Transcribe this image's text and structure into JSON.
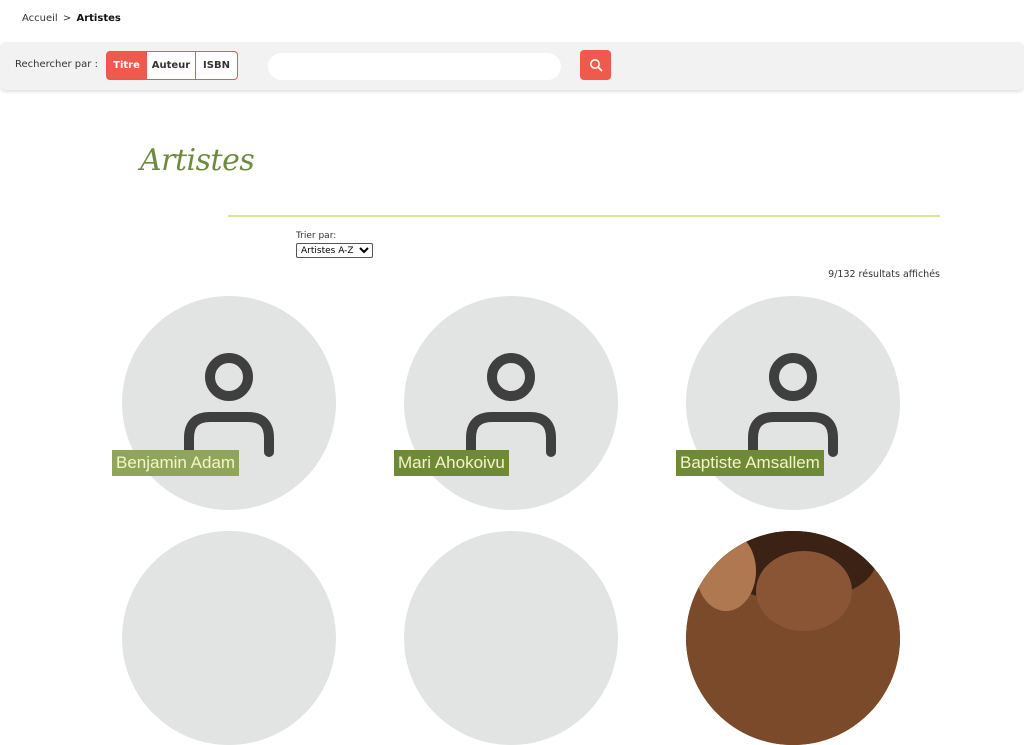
{
  "breadcrumb": {
    "home": "Accueil",
    "separator": ">",
    "current": "Artistes"
  },
  "search": {
    "label": "Rechercher par :",
    "options": [
      "Titre",
      "Auteur",
      "ISBN"
    ],
    "selected": "Titre",
    "placeholder": "",
    "value": ""
  },
  "page": {
    "title": "Artistes",
    "sort_label": "Trier par:",
    "sort_selected": "Artistes A-Z",
    "results_text": "9/132 résultats affichés"
  },
  "artists": [
    {
      "name": "Benjamin Adam"
    },
    {
      "name": "Mari Ahokoivu"
    },
    {
      "name": "Baptiste Amsallem"
    }
  ],
  "colors": {
    "accent": "#f05a4c",
    "title_green": "#6e8a3e",
    "name_bg_1": "#8fa65a",
    "name_bg_2": "#6f8a36",
    "avatar_bg": "#e2e3e3"
  }
}
